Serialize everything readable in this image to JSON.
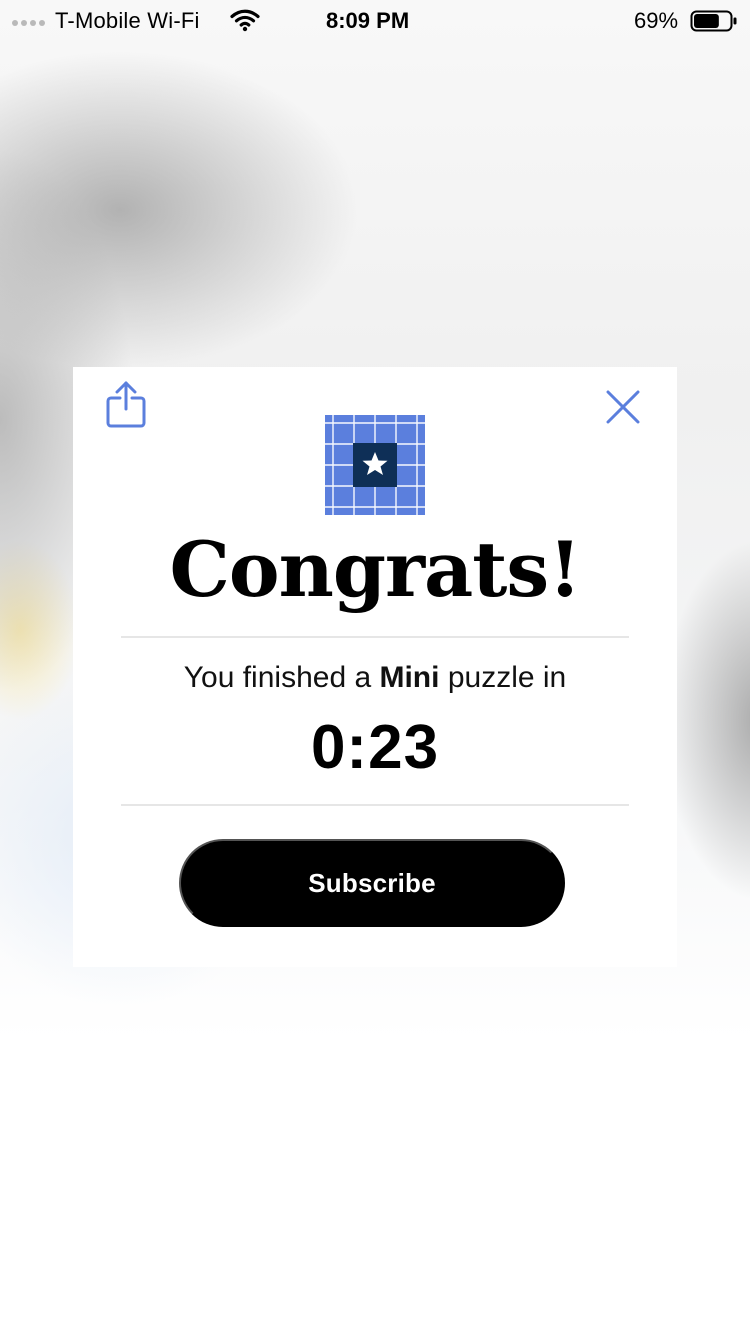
{
  "status_bar": {
    "carrier": "T-Mobile Wi-Fi",
    "time": "8:09 PM",
    "battery_percent": "69%",
    "battery_level": 0.69,
    "signal_icon": "signal-dots-icon",
    "wifi_icon": "wifi-icon",
    "battery_icon": "battery-icon"
  },
  "modal": {
    "share_icon": "share-icon",
    "close_icon": "close-icon",
    "puzzle_icon": "mini-crossword-star-icon",
    "title": "Congrats!",
    "message_prefix": "You finished a ",
    "message_highlight": "Mini",
    "message_suffix": " puzzle in",
    "elapsed_time": "0:23",
    "subscribe_label": "Subscribe"
  },
  "colors": {
    "accent_blue": "#5b7fdd",
    "dark_navy": "#0e2f57",
    "button_black": "#000000",
    "text_white": "#ffffff"
  }
}
